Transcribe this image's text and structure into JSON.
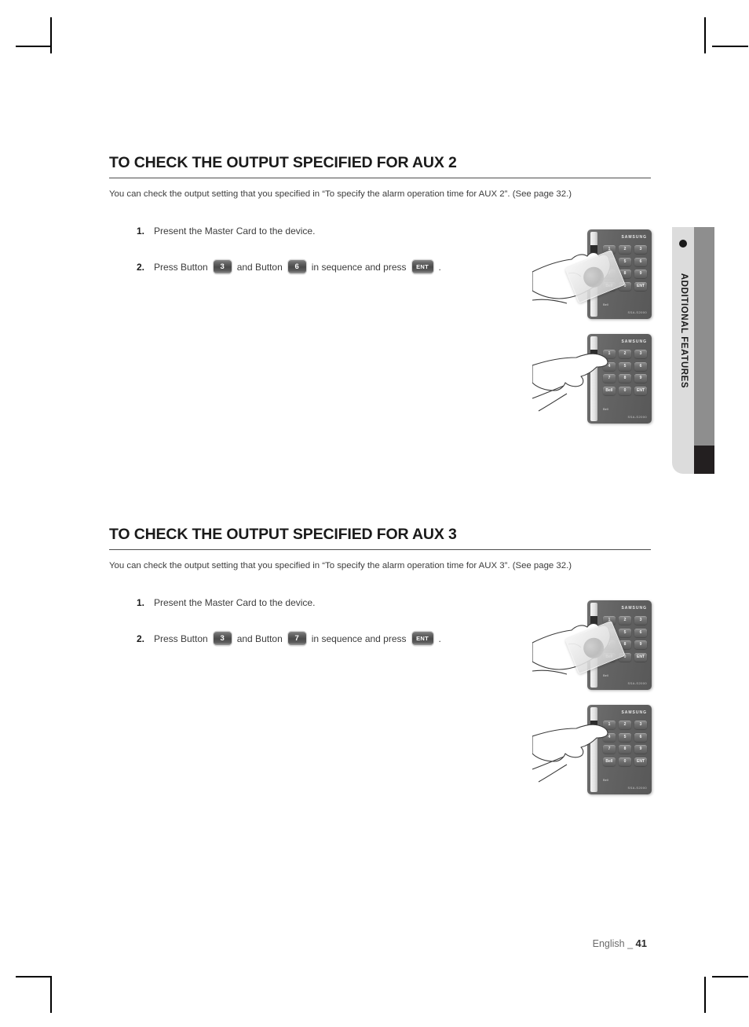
{
  "document": {
    "footer_language": "English _",
    "footer_page": "41"
  },
  "side_tab": {
    "label": "ADDITIONAL FEATURES",
    "colors": {
      "light": "#dcdcdc",
      "mid": "#8e8e8e",
      "dark": "#231f20"
    }
  },
  "sections": [
    {
      "title": "TO CHECK THE OUTPUT SPECIFIED FOR AUX 2",
      "intro": "You can check the output setting that you specified in “To specify the alarm operation time for AUX 2”. (See page 32.)",
      "steps": [
        {
          "number": "1.",
          "parts": [
            {
              "type": "text",
              "value": "Present the Master Card to the device."
            }
          ]
        },
        {
          "number": "2.",
          "parts": [
            {
              "type": "text",
              "value": "Press Button"
            },
            {
              "type": "key",
              "value": "3"
            },
            {
              "type": "text",
              "value": "and Button"
            },
            {
              "type": "key",
              "value": "6"
            },
            {
              "type": "text",
              "value": "in sequence and press"
            },
            {
              "type": "key",
              "value": "ENT"
            },
            {
              "type": "text",
              "value": "."
            }
          ]
        }
      ],
      "illustrations": [
        {
          "name": "present-master-card",
          "brand": "SAMSUNG",
          "model": "SSA-S2000",
          "bell_label": "Bell",
          "keys": [
            "1",
            "2",
            "3",
            "4",
            "5",
            "6",
            "7",
            "8",
            "9",
            "Bell",
            "0",
            "ENT"
          ],
          "has_card": true
        },
        {
          "name": "press-keypad-button",
          "brand": "SAMSUNG",
          "model": "SSA-S2000",
          "bell_label": "Bell",
          "keys": [
            "1",
            "2",
            "3",
            "4",
            "5",
            "6",
            "7",
            "8",
            "9",
            "Bell",
            "0",
            "ENT"
          ],
          "has_card": false
        }
      ]
    },
    {
      "title": "TO CHECK THE OUTPUT SPECIFIED FOR AUX 3",
      "intro": "You can check the output setting that you specified in “To specify the alarm operation time for AUX 3”. (See page 32.)",
      "steps": [
        {
          "number": "1.",
          "parts": [
            {
              "type": "text",
              "value": "Present the Master Card to the device."
            }
          ]
        },
        {
          "number": "2.",
          "parts": [
            {
              "type": "text",
              "value": "Press Button"
            },
            {
              "type": "key",
              "value": "3"
            },
            {
              "type": "text",
              "value": "and Button"
            },
            {
              "type": "key",
              "value": "7"
            },
            {
              "type": "text",
              "value": "in sequence and press"
            },
            {
              "type": "key",
              "value": "ENT"
            },
            {
              "type": "text",
              "value": "."
            }
          ]
        }
      ],
      "illustrations": [
        {
          "name": "present-master-card",
          "brand": "SAMSUNG",
          "model": "SSA-S2000",
          "bell_label": "Bell",
          "keys": [
            "1",
            "2",
            "3",
            "4",
            "5",
            "6",
            "7",
            "8",
            "9",
            "Bell",
            "0",
            "ENT"
          ],
          "has_card": true
        },
        {
          "name": "press-keypad-button",
          "brand": "SAMSUNG",
          "model": "SSA-S2000",
          "bell_label": "Bell",
          "keys": [
            "1",
            "2",
            "3",
            "4",
            "5",
            "6",
            "7",
            "8",
            "9",
            "Bell",
            "0",
            "ENT"
          ],
          "has_card": false
        }
      ]
    }
  ]
}
